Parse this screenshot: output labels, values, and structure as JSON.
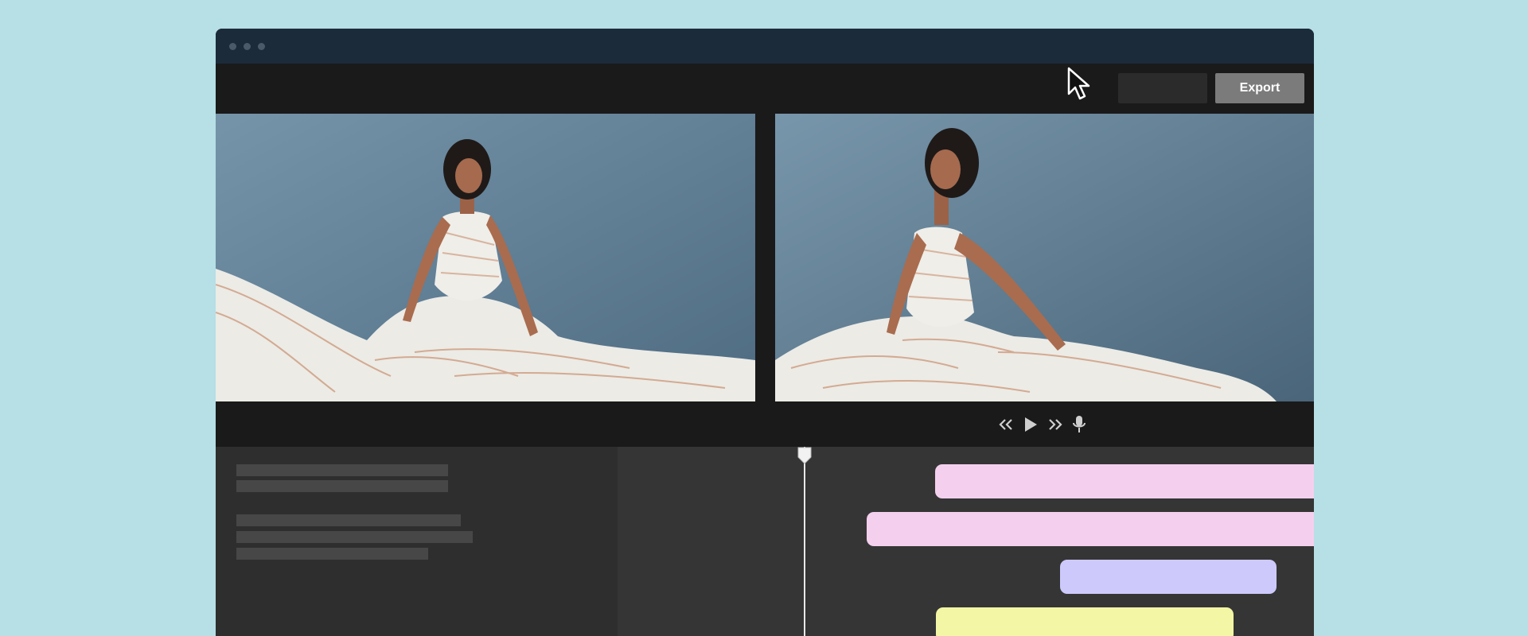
{
  "window": {
    "title_dots": [
      "dot",
      "dot",
      "dot"
    ]
  },
  "toolbar": {
    "export_label": "Export"
  },
  "colors": {
    "background": "#b6dfe6",
    "titlebar": "#1c2b3a",
    "panel": "#1a1a1a",
    "export_button": "#7b7b7b",
    "clip_pink": "#f5d0ee",
    "clip_purple": "#cdc9fb",
    "clip_yellow": "#f3f6a5"
  },
  "transport": {
    "icons": [
      "rewind-icon",
      "play-icon",
      "fast-forward-icon",
      "microphone-icon"
    ]
  },
  "timeline": {
    "clips": [
      {
        "name": "clip-1",
        "color": "pink"
      },
      {
        "name": "clip-2",
        "color": "pink"
      },
      {
        "name": "clip-3",
        "color": "purple"
      },
      {
        "name": "clip-4",
        "color": "yellow"
      }
    ]
  }
}
